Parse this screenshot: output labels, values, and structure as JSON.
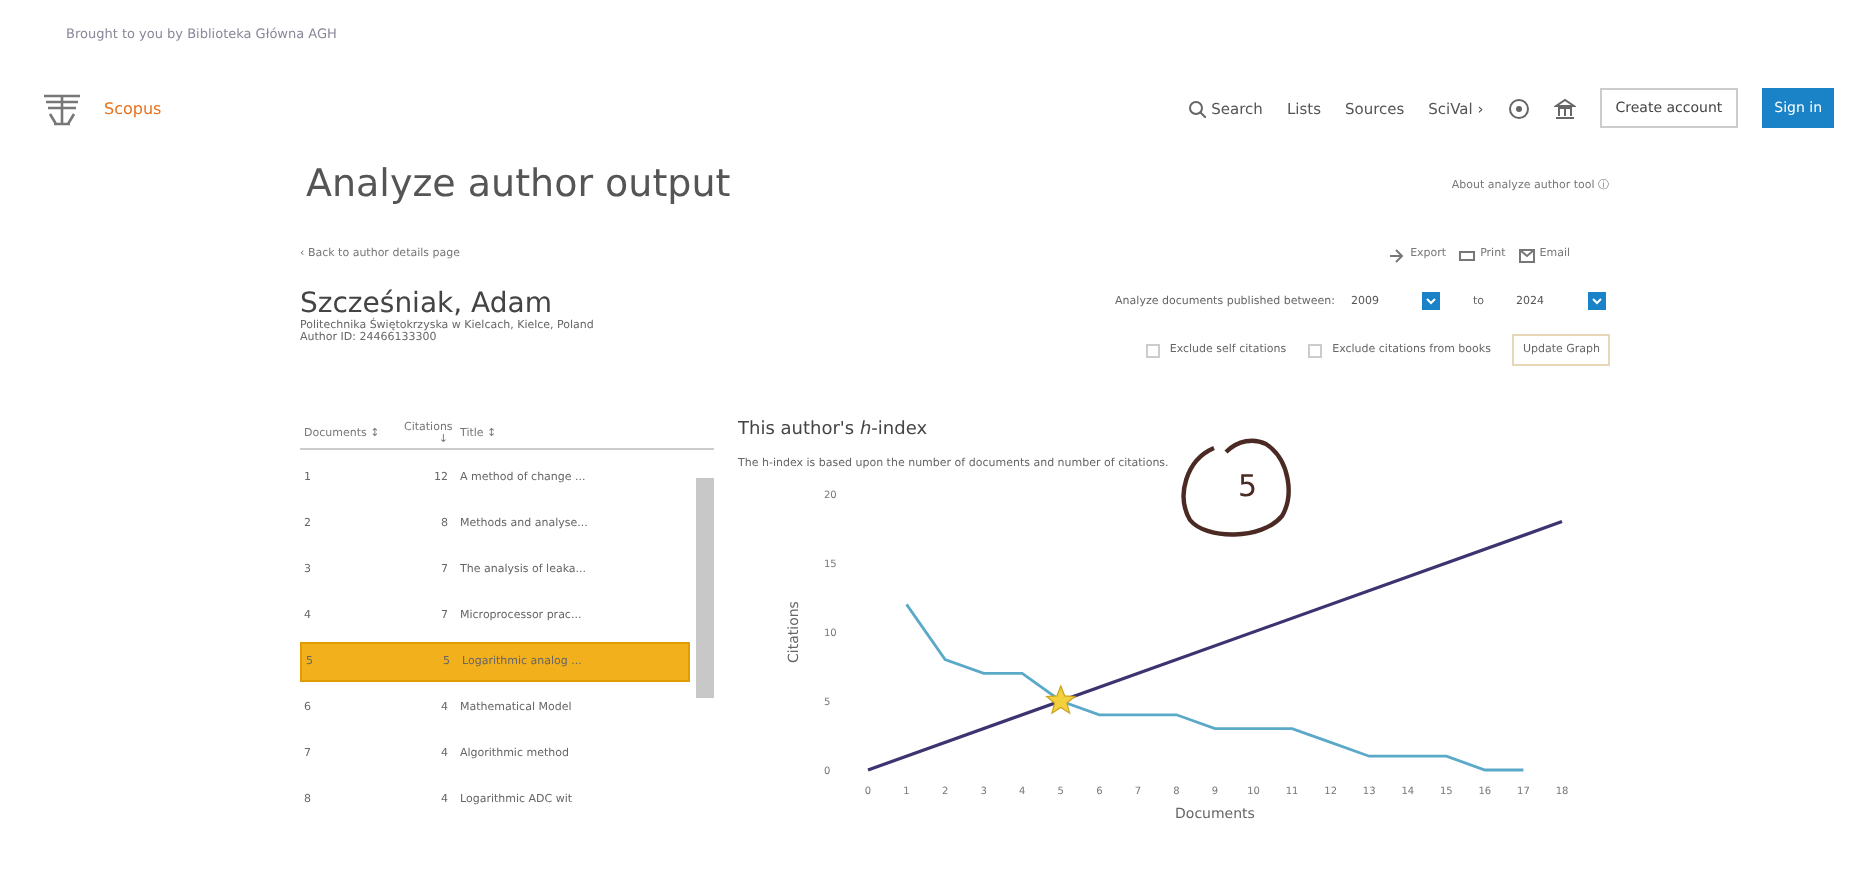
{
  "banner": "Brought to you by Biblioteka Główna AGH",
  "header": {
    "logo": "Scopus",
    "nav": [
      {
        "label": "Search",
        "kind": "search"
      },
      {
        "label": "Lists",
        "kind": "link"
      },
      {
        "label": "Sources",
        "kind": "link"
      },
      {
        "label": "SciVal ›",
        "kind": "link"
      }
    ],
    "create_account": "Create account",
    "sign_in": "Sign in"
  },
  "page_title": "Analyze author output",
  "about_link": "About analyze author tool ⓘ",
  "back_link": "‹ Back to author details page",
  "actions": [
    "Export",
    "Print",
    "Email"
  ],
  "author": {
    "name": "Szcześniak, Adam",
    "affiliation": "Politechnika Świętokrzyska w Kielcach, Kielce, Poland",
    "author_id": "Author ID: 24466133300"
  },
  "range": {
    "label": "Analyze documents published between:",
    "from": "2009",
    "to_label": "to",
    "to": "2024"
  },
  "options": [
    {
      "label": "Exclude self citations",
      "checked": false
    },
    {
      "label": "Exclude citations from books",
      "checked": false
    }
  ],
  "update_button": "Update Graph",
  "table": {
    "columns": [
      "Documents ↕",
      "Citations ↓",
      "Title ↕"
    ],
    "rows": [
      {
        "cells": [
          "1",
          "12",
          "A method of change ..."
        ],
        "selected": false
      },
      {
        "cells": [
          "2",
          "8",
          "Methods and analyse..."
        ],
        "selected": false
      },
      {
        "cells": [
          "3",
          "7",
          "The analysis of leaka..."
        ],
        "selected": false
      },
      {
        "cells": [
          "4",
          "7",
          "Microprocessor prac..."
        ],
        "selected": false
      },
      {
        "cells": [
          "5",
          "5",
          "Logarithmic analog ..."
        ],
        "selected": true
      },
      {
        "cells": [
          "6",
          "4",
          "Mathematical Model"
        ],
        "selected": false
      },
      {
        "cells": [
          "7",
          "4",
          "Algorithmic method"
        ],
        "selected": false
      },
      {
        "cells": [
          "8",
          "4",
          "Logarithmic ADC wit"
        ],
        "selected": false
      }
    ]
  },
  "hindex": {
    "title": "This author's *h*-index",
    "subtitle": "The h-index is based upon the number of documents and number of citations.",
    "chart_data": {
      "type": "line",
      "xlabel": "Documents",
      "ylabel": "Citations",
      "xlim": [
        0,
        18
      ],
      "ylim": [
        0,
        20
      ],
      "xticks": [
        0,
        1,
        2,
        3,
        4,
        5,
        6,
        7,
        8,
        9,
        10,
        11,
        12,
        13,
        14,
        15,
        16,
        17,
        18
      ],
      "yticks": [
        0,
        5,
        10,
        15,
        20
      ],
      "series": [
        {
          "color": "#5aa9c9",
          "x": [
            1,
            2,
            3,
            4,
            5,
            6,
            7,
            8,
            9,
            10,
            11,
            12,
            13,
            14,
            15,
            16,
            17
          ],
          "values": [
            12,
            8,
            7,
            7,
            5,
            4,
            4,
            4,
            3,
            3,
            3,
            2,
            1,
            1,
            1,
            0,
            0
          ]
        },
        {
          "color": "#3b3470",
          "x": [
            0,
            18
          ],
          "values": [
            0,
            18
          ]
        }
      ]
    }
  },
  "handwritten_note": "5"
}
